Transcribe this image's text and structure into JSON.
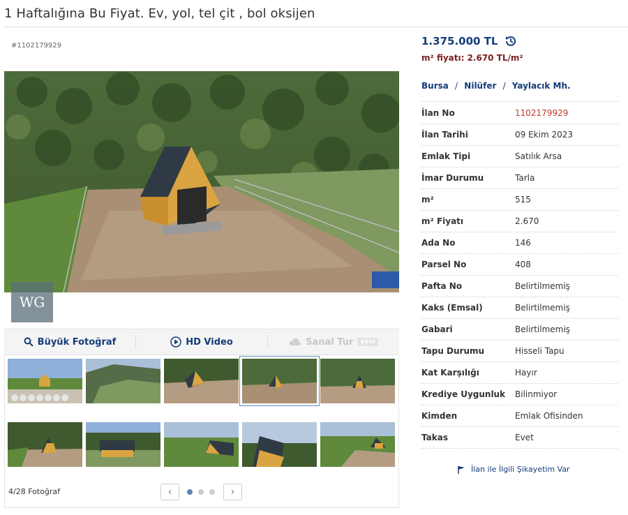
{
  "listing": {
    "title": "1 Haftalığına Bu Fiyat. Ev, yol, tel çit , bol oksijen",
    "id_label": "#1102179929"
  },
  "price": {
    "value": "1.375.000 TL",
    "icon": "history-icon",
    "m2_price": "m² fiyatı: 2.670 TL/m²"
  },
  "location": [
    "Bursa",
    "Nilüfer",
    "Yaylacık Mh."
  ],
  "details": [
    {
      "key": "İlan No",
      "value": "1102179929"
    },
    {
      "key": "İlan Tarihi",
      "value": "09 Ekim 2023"
    },
    {
      "key": "Emlak Tipi",
      "value": "Satılık Arsa"
    },
    {
      "key": "İmar Durumu",
      "value": "Tarla"
    },
    {
      "key": "m²",
      "value": "515"
    },
    {
      "key": "m² Fiyatı",
      "value": "2.670"
    },
    {
      "key": "Ada No",
      "value": "146"
    },
    {
      "key": "Parsel No",
      "value": "408"
    },
    {
      "key": "Pafta No",
      "value": "Belirtilmemiş"
    },
    {
      "key": "Kaks (Emsal)",
      "value": "Belirtilmemiş"
    },
    {
      "key": "Gabari",
      "value": "Belirtilmemiş"
    },
    {
      "key": "Tapu Durumu",
      "value": "Hisseli Tapu"
    },
    {
      "key": "Kat Karşılığı",
      "value": "Hayır"
    },
    {
      "key": "Krediye Uygunluk",
      "value": "Bilinmiyor"
    },
    {
      "key": "Kimden",
      "value": "Emlak Ofisinden"
    },
    {
      "key": "Takas",
      "value": "Evet"
    }
  ],
  "media": {
    "big_photo": "Büyük Fotoğraf",
    "hd_video": "HD Video",
    "virtual_tour": "Sanal Tur",
    "new_badge": "yeni",
    "watermark": "WG"
  },
  "gallery": {
    "counter": "4/28 Fotoğraf",
    "active_index": 4,
    "prev": "‹",
    "next": "›"
  },
  "complaint_link": "İlan ile İlgili Şikayetim Var",
  "colors": {
    "link_blue": "#153c79",
    "id_red": "#c0392b",
    "m2_price": "#7a1f1f"
  }
}
